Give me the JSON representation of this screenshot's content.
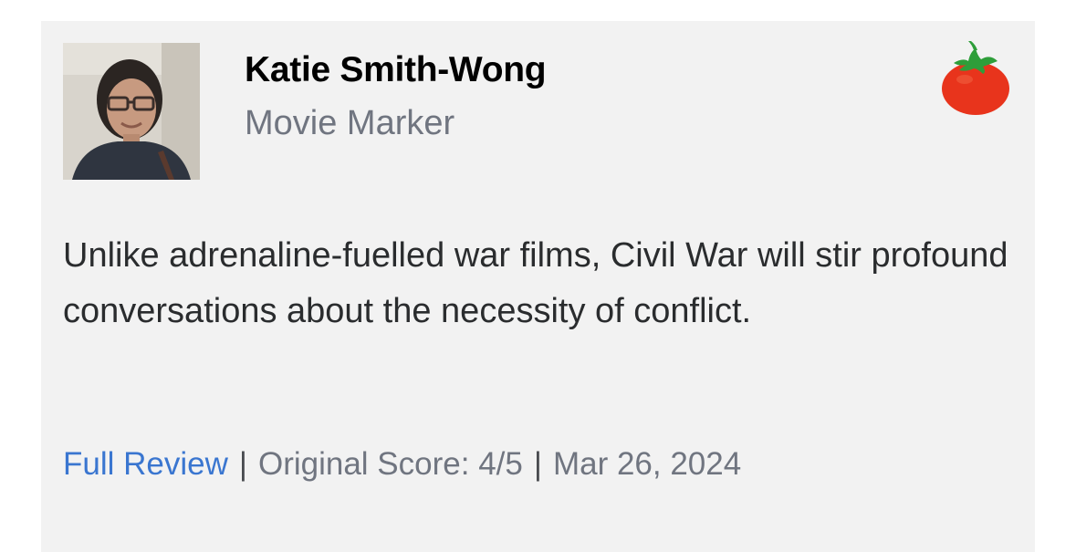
{
  "review": {
    "critic_name": "Katie Smith-Wong",
    "publication": "Movie Marker",
    "quote": "Unlike adrenaline-fuelled war films, Civil War will stir profound conversations about the necessity of conflict.",
    "full_review_label": "Full Review",
    "separator": "|",
    "original_score": "Original Score: 4/5",
    "date": "Mar 26, 2024",
    "rating_icon": "fresh-tomato-icon"
  },
  "colors": {
    "card_background": "#f2f2f2",
    "link": "#3a76d0",
    "muted_text": "#707580",
    "tomato_red": "#e8341c",
    "tomato_leaf": "#2e9e3a"
  }
}
